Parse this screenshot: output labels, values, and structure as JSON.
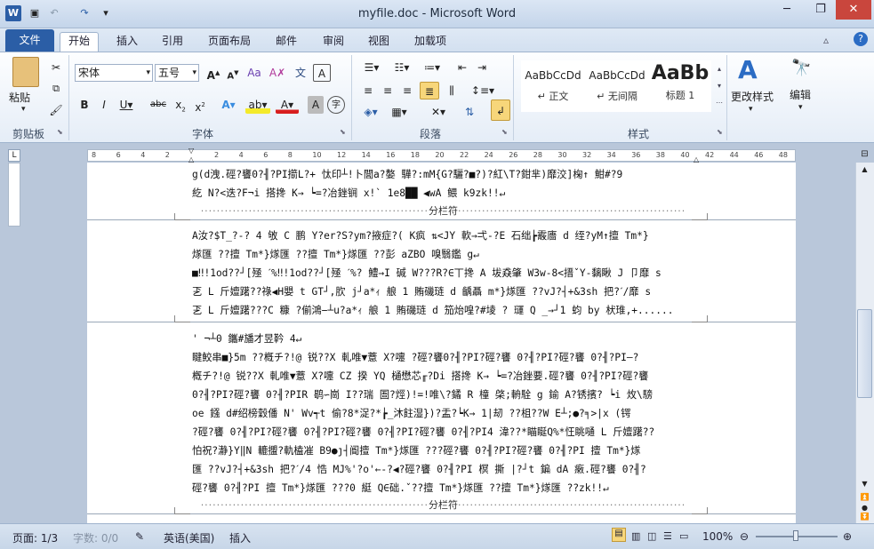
{
  "window": {
    "title": "myfile.doc - Microsoft Word",
    "minimize": "─",
    "restore": "❐",
    "close": "✕"
  },
  "tabs": {
    "file": "文件",
    "items": [
      "开始",
      "插入",
      "引用",
      "页面布局",
      "邮件",
      "审阅",
      "视图",
      "加载项"
    ]
  },
  "ribbon": {
    "paste": "粘贴",
    "font_name": "宋体",
    "font_size": "五号",
    "clipboard_label": "剪贴板",
    "font_label": "字体",
    "paragraph_label": "段落",
    "styles_label": "样式",
    "styles": [
      {
        "preview": "AaBbCcDd",
        "name": "↵ 正文"
      },
      {
        "preview": "AaBbCcDd",
        "name": "↵ 无间隔"
      },
      {
        "preview": "AaBb",
        "name": "标题 1"
      }
    ],
    "change_styles": "更改样式",
    "edit": "编辑"
  },
  "ruler": {
    "ticks": [
      "8",
      "6",
      "4",
      "2",
      "",
      "2",
      "4",
      "6",
      "8",
      "10",
      "12",
      "14",
      "16",
      "18",
      "20",
      "22",
      "24",
      "26",
      "28",
      "30",
      "32",
      "34",
      "36",
      "38",
      "40",
      "42",
      "44",
      "46",
      "48"
    ]
  },
  "document": {
    "column_break": "分栏符",
    "lines": [
      "g(d洩.硜?饔0?╢?PI擶L?+  忲印┴!卜閭a?嫯 驊?:mM{G?驪?■?)?紅\\T?鉗芈)靡洨]椈↑ 魽#?9",
      "紇 N?<迭?F¬i 搭搀 K→ ┕=?冶銼锎 x!` 1e8██ ◀wA 鳂 k9zk!!↵",
      "A汝?$T_?-? 4 敂 C 鹏 Y?er?S?ym?掖症?(    K疯   ⇅<JY 軟→弌-?E 石绌┢霰廧 d 绖?yM↑擅 Tm*}",
      "煫匯   ??擅 Tm*}煫匯   ??擅 Tm*}煫匯   ??彭 aZBO 嗅翳鑑 g↵",
      "■‼!1od??┘[殛 ˊ%‼!1od??┘[殛 ˊ%? 鱧→I 碱 W???R?∈丅搀 A 坺猋肇 W3w-8<搢ˇY-黐瞅 J 卩靡 s",
      "乤 L 斤嬗躇??祿◀H嬰 t    GT┘,肷 j┘a*ｨ 艆 1 賄磯琏 d 齲聶 m*}煫匯   ??vJ?┤+&3sh 把?ˊ/靡 s",
      "乤 L 斤嬗躇???C 糠   ?偂鴻−┴u?a*ｨ 艆 1 賄磯琏 d 笳炲喤?#堎 ? 璭 Q    _→┘1 蚐 by 枤琟,+......",
      "' ¬┴0 鑴#旙才昱靲 4↵",
      " 睷鮫串■}5m   ??槪チ?!@ 锐??X 軋唯▼薏 X?嚏 ?硜?饔0?╢?PI?硜?饔 0?╢?PI?硜?饔 0?╢?PI—?",
      "槪チ?!@ 锐??X 軋唯▼薏 X?嚏 CZ 揆 YQ 樋懋芯╓?Di 搭搀 K→ ┕=?冶銼要.硜?饔 0?╢?PI?硜?饔",
      "0?╢?PI?硜?饔 0?╢?PIR 鹖∽崗 I??瑞 圄?烴)!=!唯\\?鐍 R 橦 棨;輈駩 g 鍮 A?锈擯?  ┕i 炇\\騯",
      "oe 鏹 d#绍榜穀僠 N' Wv┭t 偷?8*浞?*┢_沐飳湿})?盂?┕K→ 1|刼  ??柤??W E┴;●?╕>|x  (锷",
      "   ?硜?饔 0?╢?PI?硜?饔 0?╢?PI?硜?饔 0?╢?PI?硜?饔 0?╢?PI4 湋??*瞄䀽Q%*忹眺嗵 L 斤嬗躇??",
      "怕祝?瀞}Y‖N 轆擝?軌榼凗 B9●ȷ┤阍擅 Tm*}煫匯    ???硜?饔 0?╢?PI?硜?饔 0?╢?PI 擅 Tm*}煫",
      "匯   ??vJ?┤+&3sh 把?ˊ/4 悎 MJ%'?o'←-?◀?硜?饔 0?╢?PI 榠   撕  |?┘t 鍽 dA 瘷.硜?饔 0?╢?",
      "硜?饔 0?╢?PI 擅 Tm*}煫匯   ???0 綎 Q∈础.ˇ??擅 Tm*}煫匯   ??擅 Tm*}煫匯   ??zk!!↵"
    ]
  },
  "status": {
    "page": "页面: 1/3",
    "words": "字数: 0/0",
    "language": "英语(美国)",
    "mode": "插入",
    "zoom": "100%"
  }
}
